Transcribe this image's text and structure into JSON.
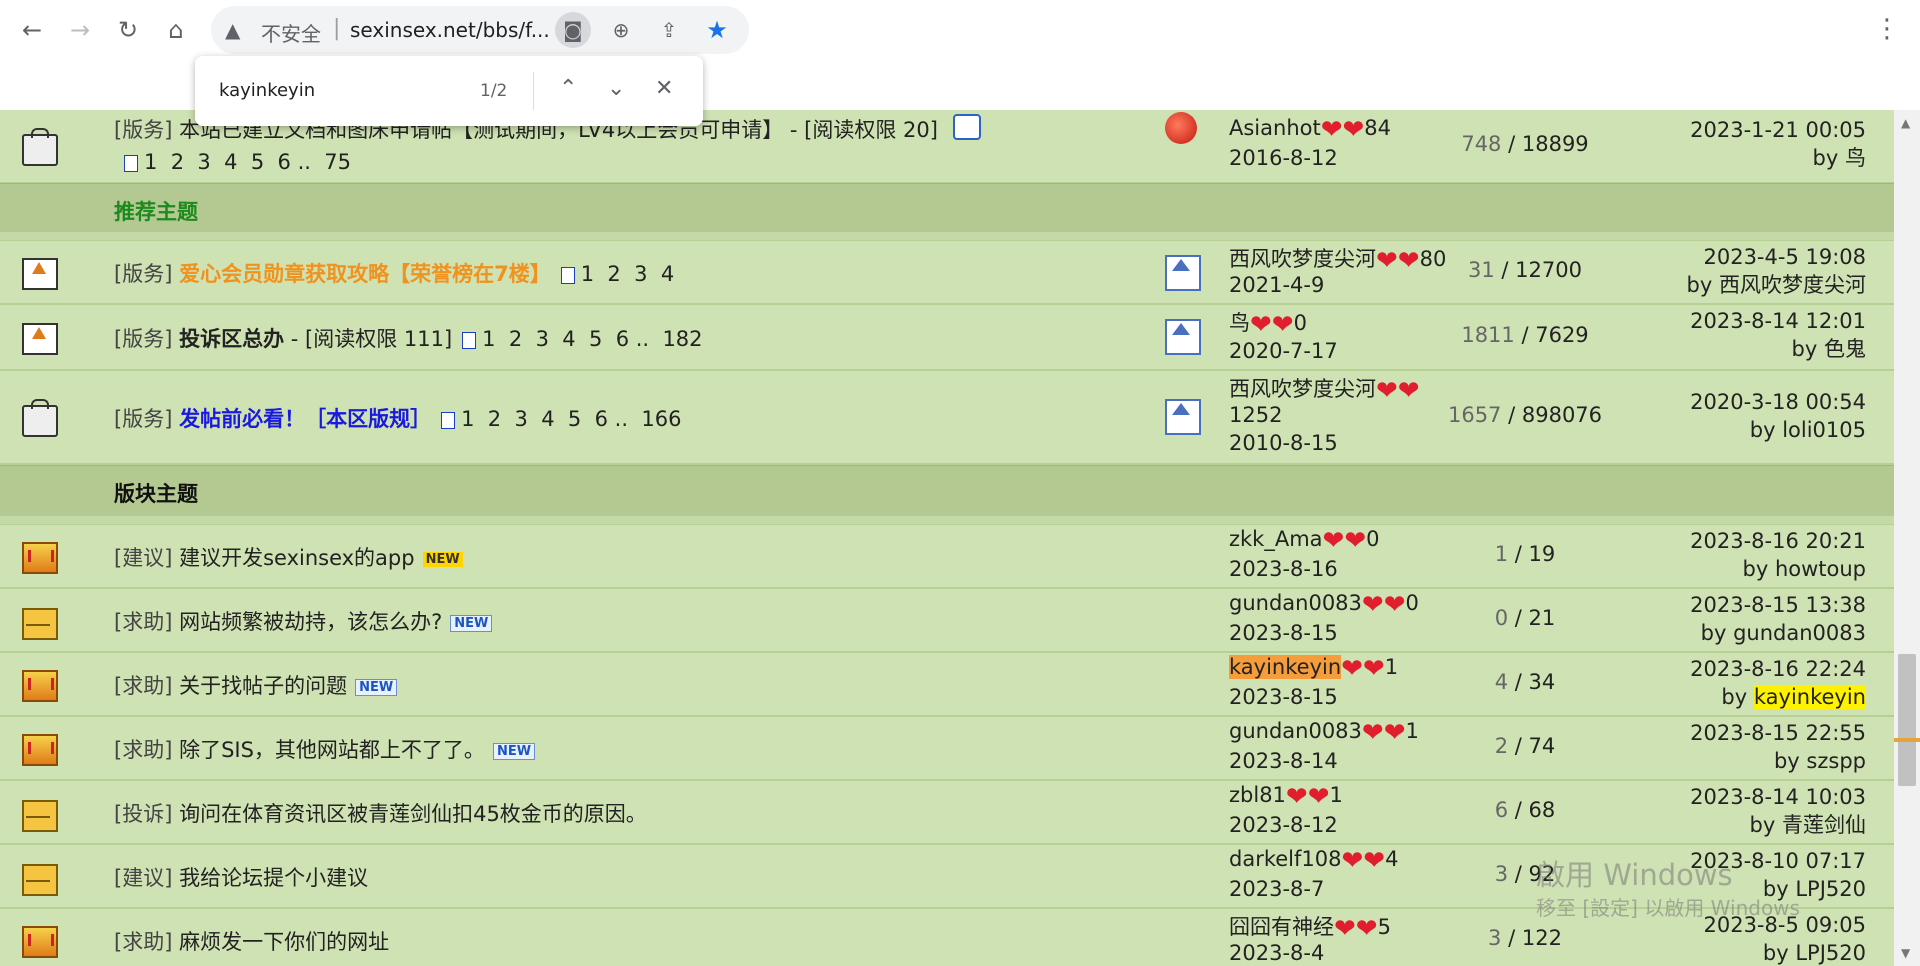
{
  "browser": {
    "insecure_label": "不安全",
    "separator": "|",
    "url": "sexinsex.net/bbs/f...",
    "find_query": "kayinkeyin",
    "find_count": "1/2",
    "icons": {
      "back": "←",
      "forward": "→",
      "reload": "↻",
      "home": "⌂",
      "warn": "▲",
      "lens": "◙",
      "zoom": "⊕",
      "share": "⇪",
      "star": "★",
      "menu": "⋮",
      "up": "⌃",
      "down": "⌄",
      "close": "✕"
    }
  },
  "sections": {
    "recommended": "推荐主题",
    "board": "版块主题"
  },
  "rows": [
    {
      "tag": "[版务]",
      "title": "本站已建立文档和图床申请帖【测试期间，LV4以上会员可申请】 - [阅读权限 20]",
      "pages": "1  2  3  4  5  6 ..  75",
      "author": "Asianhot",
      "author_level": "84",
      "date": "2016-8-12",
      "replies": "748",
      "views": "18899",
      "last_time": "2023-1-21 00:05",
      "last_by_prefix": "by",
      "last_by": "鸟"
    },
    {
      "tag": "[版务]",
      "title": "爱心会员勋章获取攻略【荣誉榜在7楼】",
      "pages": "1  2  3  4",
      "author": "西风吹梦度尖河",
      "author_level": "80",
      "date": "2021-4-9",
      "replies": "31",
      "views": "12700",
      "last_time": "2023-4-5 19:08",
      "last_by_prefix": "by",
      "last_by": "西风吹梦度尖河"
    },
    {
      "tag": "[版务]",
      "title": "投诉区总办",
      "title_suffix": " - [阅读权限 111]",
      "pages": "1  2  3  4  5  6 ..  182",
      "author": "鸟",
      "author_level": "0",
      "date": "2020-7-17",
      "replies": "1811",
      "views": "7629",
      "last_time": "2023-8-14 12:01",
      "last_by_prefix": "by",
      "last_by": "色鬼"
    },
    {
      "tag": "[版务]",
      "title": "发帖前必看！［本区版规］",
      "pages": "1  2  3  4  5  6 ..  166",
      "author": "西风吹梦度尖河",
      "author_level": "1252",
      "date": "2010-8-15",
      "replies": "1657",
      "views": "898076",
      "last_time": "2020-3-18 00:54",
      "last_by_prefix": "by",
      "last_by": "loli0105"
    },
    {
      "tag": "[建议]",
      "title": "建议开发sexinsex的app",
      "badge": "NEW",
      "author": "zkk_Ama",
      "author_level": "0",
      "date": "2023-8-16",
      "replies": "1",
      "views": "19",
      "last_time": "2023-8-16 20:21",
      "last_by_prefix": "by",
      "last_by": "howtoup"
    },
    {
      "tag": "[求助]",
      "title": "网站频繁被劫持，该怎么办?",
      "badge": "NEW",
      "author": "gundan0083",
      "author_level": "0",
      "date": "2023-8-15",
      "replies": "0",
      "views": "21",
      "last_time": "2023-8-15 13:38",
      "last_by_prefix": "by",
      "last_by": "gundan0083"
    },
    {
      "tag": "[求助]",
      "title": "关于找帖子的问题",
      "badge": "NEW",
      "author": "kayinkeyin",
      "author_level": "1",
      "date": "2023-8-15",
      "replies": "4",
      "views": "34",
      "last_time": "2023-8-16 22:24",
      "last_by_prefix": "by",
      "last_by": "kayinkeyin"
    },
    {
      "tag": "[求助]",
      "title": "除了SIS，其他网站都上不了了。",
      "badge": "NEW",
      "author": "gundan0083",
      "author_level": "1",
      "date": "2023-8-14",
      "replies": "2",
      "views": "74",
      "last_time": "2023-8-15 22:55",
      "last_by_prefix": "by",
      "last_by": "szspp"
    },
    {
      "tag": "[投诉]",
      "title": "询问在体育资讯区被青莲剑仙扣45枚金币的原因。",
      "author": "zbl81",
      "author_level": "1",
      "date": "2023-8-12",
      "replies": "6",
      "views": "68",
      "last_time": "2023-8-14 10:03",
      "last_by_prefix": "by",
      "last_by": "青莲剑仙"
    },
    {
      "tag": "[建议]",
      "title": "我给论坛提个小建议",
      "author": "darkelf108",
      "author_level": "4",
      "date": "2023-8-7",
      "replies": "3",
      "views": "92",
      "last_time": "2023-8-10 07:17",
      "last_by_prefix": "by",
      "last_by": "LPJ520"
    },
    {
      "tag": "[求助]",
      "title": "麻烦发一下你们的网址",
      "author": "囧囧有神经",
      "author_level": "5",
      "date": "2023-8-4",
      "replies": "3",
      "views": "122",
      "last_time": "2023-8-5 09:05",
      "last_by_prefix": "by",
      "last_by": "LPJ520"
    }
  ],
  "watermark": {
    "line1": "啟用 Windows",
    "line2": "移至 [設定] 以啟用 Windows"
  },
  "colors": {
    "row": "#cfe2b3",
    "section": "#b4c992",
    "orange": "#f0931e",
    "blue": "#1a1adf",
    "highlight": "#fff200"
  }
}
